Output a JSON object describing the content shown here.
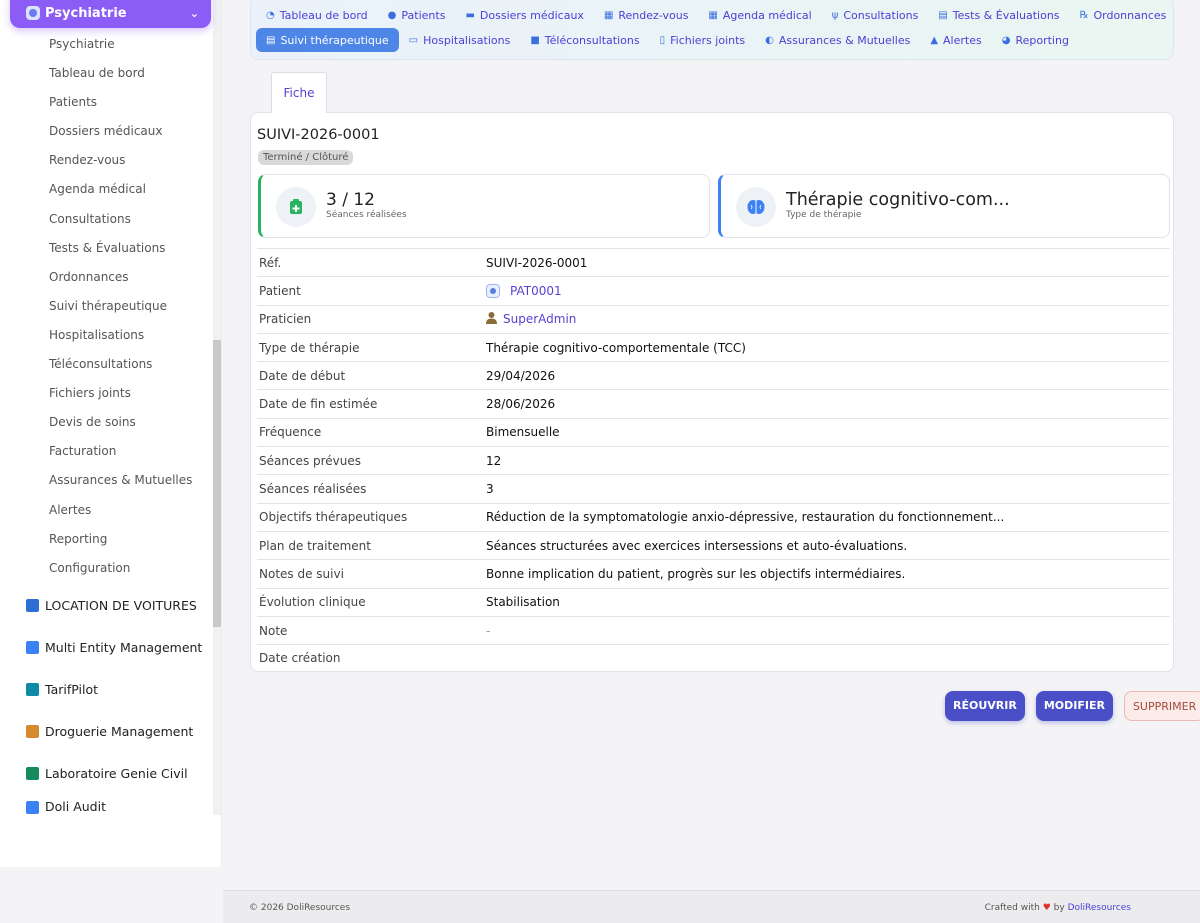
{
  "sidebar": {
    "module_title": "Psychiatrie",
    "items": [
      "Psychiatrie",
      "Tableau de bord",
      "Patients",
      "Dossiers médicaux",
      "Rendez-vous",
      "Agenda médical",
      "Consultations",
      "Tests & Évaluations",
      "Ordonnances",
      "Suivi thérapeutique",
      "Hospitalisations",
      "Téléconsultations",
      "Fichiers joints",
      "Devis de soins",
      "Facturation",
      "Assurances & Mutuelles",
      "Alertes",
      "Reporting",
      "Configuration"
    ],
    "modules": [
      {
        "label": "LOCATION DE VOITURES",
        "icon": "car-icon",
        "color": "#2e6fd6"
      },
      {
        "label": "Multi Entity Management",
        "icon": "entities-icon",
        "color": "#3b82f6"
      },
      {
        "label": "TarifPilot",
        "icon": "tarif-icon",
        "color": "#0f8aa6"
      },
      {
        "label": "Droguerie Management",
        "icon": "store-icon",
        "color": "#d68a2e"
      },
      {
        "label": "Laboratoire Genie Civil",
        "icon": "lab-icon",
        "color": "#168a5c"
      },
      {
        "label": "Doli Audit",
        "icon": "audit-icon",
        "color": "#3b82f6"
      }
    ]
  },
  "nav": {
    "row1": [
      {
        "label": "Tableau de bord",
        "icon": "◔"
      },
      {
        "label": "Patients",
        "icon": "●"
      },
      {
        "label": "Dossiers médicaux",
        "icon": "▬"
      },
      {
        "label": "Rendez-vous",
        "icon": "▦"
      },
      {
        "label": "Agenda médical",
        "icon": "▦"
      },
      {
        "label": "Consultations",
        "icon": "ψ"
      },
      {
        "label": "Tests & Évaluations",
        "icon": "▤"
      },
      {
        "label": "Ordonnances",
        "icon": "℞"
      }
    ],
    "row2": [
      {
        "label": "Suivi thérapeutique",
        "icon": "▤",
        "active": true
      },
      {
        "label": "Hospitalisations",
        "icon": "▭"
      },
      {
        "label": "Téléconsultations",
        "icon": "■"
      },
      {
        "label": "Fichiers joints",
        "icon": "▯"
      },
      {
        "label": "Assurances & Mutuelles",
        "icon": "◐"
      },
      {
        "label": "Alertes",
        "icon": "▲"
      },
      {
        "label": "Reporting",
        "icon": "◕"
      }
    ]
  },
  "card": {
    "tab_label": "Fiche",
    "ref": "SUIVI-2026-0001",
    "status": "Terminé / Clôturé",
    "kpi1": {
      "value": "3 / 12",
      "label": "Séances réalisées"
    },
    "kpi2": {
      "value": "Thérapie cognitivo-com...",
      "label": "Type de thérapie"
    }
  },
  "fields": [
    {
      "key": "Réf.",
      "value": "SUIVI-2026-0001"
    },
    {
      "key": "Patient",
      "value": "PAT0001",
      "type": "patient-link"
    },
    {
      "key": "Praticien",
      "value": "SuperAdmin",
      "type": "user-link"
    },
    {
      "key": "Type de thérapie",
      "value": "Thérapie cognitivo-comportementale (TCC)"
    },
    {
      "key": "Date de début",
      "value": "29/04/2026"
    },
    {
      "key": "Date de fin estimée",
      "value": "28/06/2026"
    },
    {
      "key": "Fréquence",
      "value": "Bimensuelle"
    },
    {
      "key": "Séances prévues",
      "value": "12"
    },
    {
      "key": "Séances réalisées",
      "value": "3"
    },
    {
      "key": "Objectifs thérapeutiques",
      "value": "Réduction de la symptomatologie anxio-dépressive, restauration du fonctionnement..."
    },
    {
      "key": "Plan de traitement",
      "value": "Séances structurées avec exercices intersessions et auto-évaluations."
    },
    {
      "key": "Notes de suivi",
      "value": "Bonne implication du patient, progrès sur les objectifs intermédiaires."
    },
    {
      "key": "Évolution clinique",
      "value": "Stabilisation"
    },
    {
      "key": "Note",
      "value": "-",
      "type": "muted"
    },
    {
      "key": "Date création",
      "value": ""
    }
  ],
  "actions": {
    "reopen": "RÉOUVRIR",
    "modify": "MODIFIER",
    "delete": "SUPPRIMER"
  },
  "footer": {
    "copyright": "© 2026 DoliResources",
    "crafted": "Crafted with",
    "heart": "♥",
    "by": "by",
    "brand": "DoliResources"
  },
  "colors": {
    "accent": "#8b5cf6",
    "primary_button": "#4a4fc7",
    "active_tab": "#4e86e8",
    "kpi_green": "#27b360",
    "kpi_blue": "#3b82f6"
  }
}
